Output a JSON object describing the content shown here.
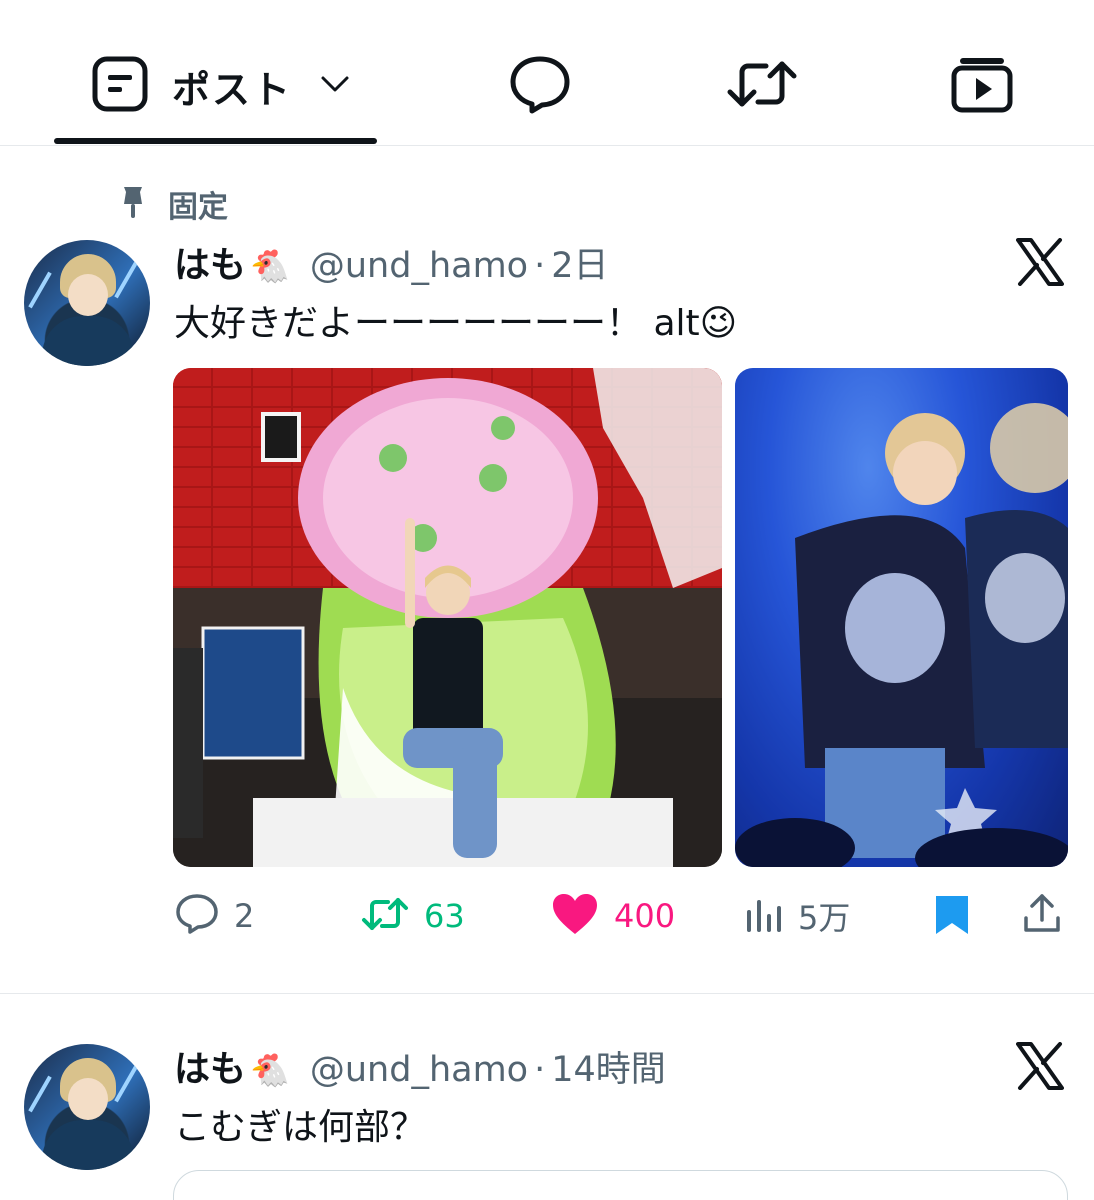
{
  "tabs": {
    "posts": {
      "label": "ポスト",
      "icon": "post-icon",
      "dropdown_icon": "chevron-down-icon",
      "selected": true
    },
    "replies": {
      "icon": "reply-bubble-icon"
    },
    "reposts": {
      "icon": "repost-icon"
    },
    "media": {
      "icon": "video-icon"
    }
  },
  "tweets": [
    {
      "pinned_label": "固定",
      "author_name": "はも",
      "author_emoji": "🐔",
      "handle": "@und_hamo",
      "separator": "·",
      "time": "2日",
      "source_icon": "x-logo-icon",
      "text": "大好きだよーーーーーーー！ alt😉",
      "media": [
        {
          "kind": "photo",
          "description_icon": "birthday-flower-stand-photo"
        },
        {
          "kind": "photo",
          "description_icon": "stage-singing-photo"
        }
      ],
      "stats": {
        "replies": "2",
        "reposts": "63",
        "likes": "400",
        "views": "5万"
      },
      "liked": true,
      "bookmarked": true,
      "colors": {
        "repost": "#00ba7c",
        "like": "#f91880",
        "bookmark": "#1d9bf0",
        "muted": "#536471"
      }
    },
    {
      "author_name": "はも",
      "author_emoji": "🐔",
      "handle": "@und_hamo",
      "separator": "·",
      "time": "14時間",
      "source_icon": "x-logo-icon",
      "text": "こむぎは何部？"
    }
  ]
}
